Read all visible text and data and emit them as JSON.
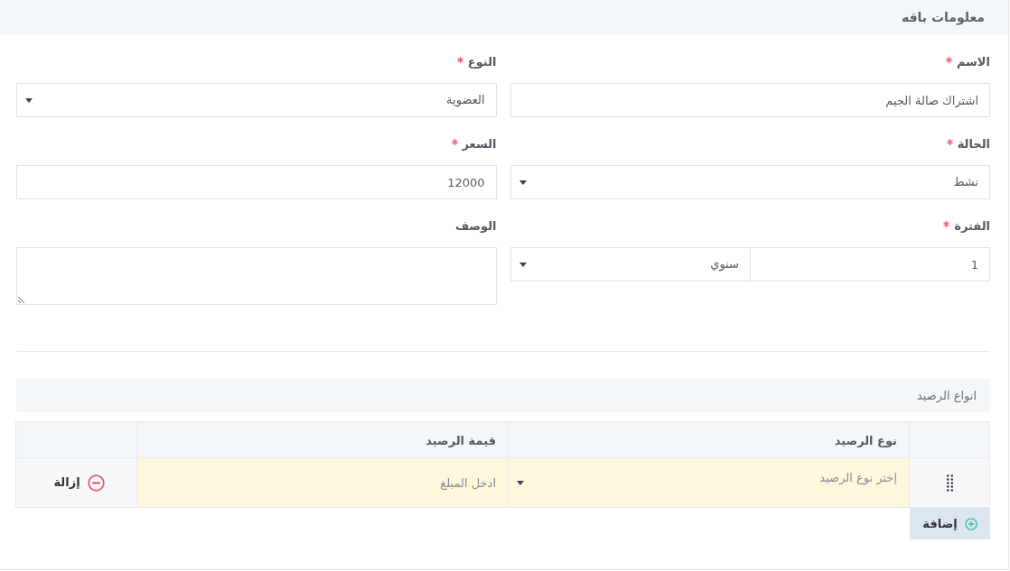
{
  "header": {
    "title": "معلومات باقه"
  },
  "fields": [
    {
      "label": "الاسم",
      "required": true,
      "kind": "text",
      "value": "اشتراك صالة الجيم"
    },
    {
      "label": "النوع",
      "required": true,
      "kind": "select",
      "value": "العضوية"
    },
    {
      "label": "الحالة",
      "required": true,
      "kind": "select",
      "value": "نشط"
    },
    {
      "label": "السعر",
      "required": true,
      "kind": "text",
      "value": "12000"
    },
    {
      "label": "الفترة",
      "required": true,
      "kind": "period",
      "value": "1",
      "unit": "سنوي"
    },
    {
      "label": "الوصف",
      "required": false,
      "kind": "textarea"
    }
  ],
  "balance_types": {
    "title": "انواع الرصيد",
    "columns": [
      {
        "label": "نوع الرصيد"
      },
      {
        "label": "قيمة الرصيد"
      }
    ],
    "rows": [
      {
        "type": {
          "placeholder": "إختر نوع الرصيد"
        },
        "amount": {
          "placeholder": "ادخل المبلغ"
        },
        "remove_label": "إزالة"
      }
    ],
    "add_button": {
      "label": "إضافة"
    }
  }
}
